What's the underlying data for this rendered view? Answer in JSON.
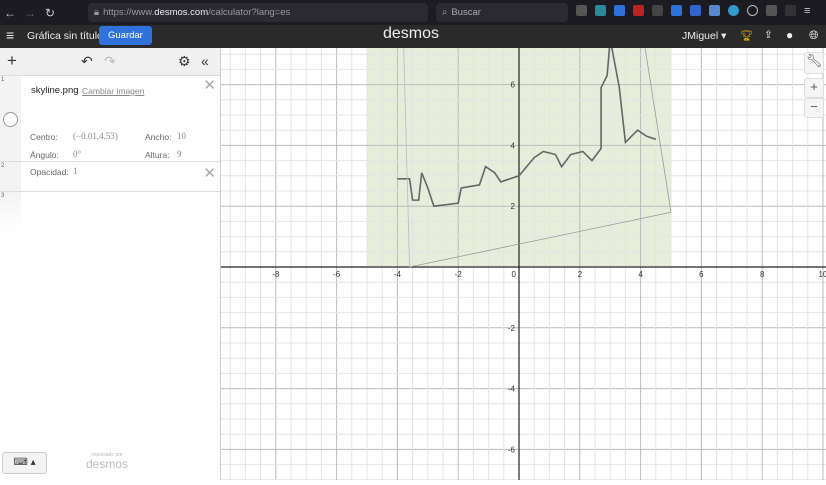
{
  "browser": {
    "url_prefix": "https://www.",
    "url_domain": "desmos.com",
    "url_path": "/calculator?lang=es",
    "search_placeholder": "Buscar"
  },
  "header": {
    "title": "Gráfica sin título",
    "save_label": "Guardar",
    "logo": "desmos",
    "user": "JMiguel"
  },
  "expressions": [
    {
      "index": "1",
      "filename": "skyline.png",
      "change_label": "Cambiar imagen",
      "center_label": "Centro:",
      "center_value": "(−0.01,4.53)",
      "width_label": "Ancho:",
      "width_value": "10",
      "angle_label": "Ángulo:",
      "angle_value": "0°",
      "height_label": "Altura:",
      "height_value": "9",
      "opacity_label": "Opacidad:",
      "opacity_value": "1"
    },
    {
      "index": "2"
    },
    {
      "index": "3"
    }
  ],
  "footer": {
    "powered_small": "impulsado por",
    "powered_logo": "desmos"
  },
  "graph": {
    "x_ticks": [
      "-8",
      "-6",
      "-4",
      "-2",
      "2",
      "4",
      "6",
      "8",
      "10"
    ],
    "y_ticks": [
      "6",
      "4",
      "2",
      "-2",
      "-4",
      "-6"
    ],
    "origin_label": "0",
    "image": {
      "center": [
        -0.01,
        4.53
      ],
      "width": 10,
      "height": 9
    }
  },
  "colors": {
    "accent": "#2f72dc",
    "header": "#2a2a2a"
  }
}
